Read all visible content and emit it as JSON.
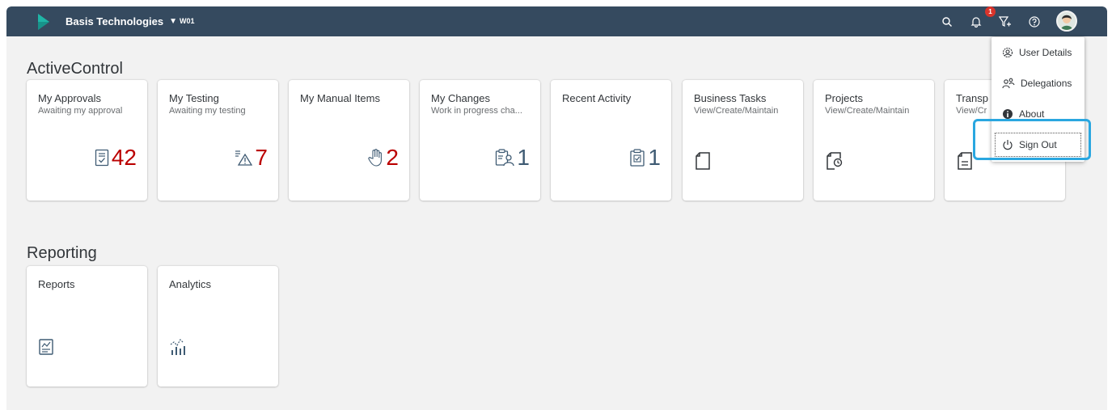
{
  "shell": {
    "company": "Basis Technologies",
    "system": "W01",
    "notification_count": "1",
    "colors": {
      "bar": "#354a5f",
      "logo": "#1fb5a6",
      "kpi_red": "#bb0000",
      "icon_blue": "#3f5b73"
    }
  },
  "active_control": {
    "title": "ActiveControl",
    "tiles": [
      {
        "title": "My Approvals",
        "subtitle": "Awaiting my approval",
        "value": "42",
        "icon": "approval-doc-icon"
      },
      {
        "title": "My Testing",
        "subtitle": "Awaiting my testing",
        "value": "7",
        "icon": "warning-list-icon"
      },
      {
        "title": "My Manual Items",
        "subtitle": "",
        "value": "2",
        "icon": "hand-icon"
      },
      {
        "title": "My Changes",
        "subtitle": "Work in progress cha...",
        "value": "1",
        "icon": "clipboard-person-icon"
      },
      {
        "title": "Recent Activity",
        "subtitle": "",
        "value": "1",
        "icon": "clipboard-check-icon"
      },
      {
        "title": "Business Tasks",
        "subtitle": "View/Create/Maintain",
        "value": "",
        "icon": "document-icon"
      },
      {
        "title": "Projects",
        "subtitle": "View/Create/Maintain",
        "value": "",
        "icon": "document-clock-icon"
      },
      {
        "title": "Transp",
        "subtitle": "View/Cr",
        "value": "",
        "icon": "document-text-icon"
      }
    ]
  },
  "reporting": {
    "title": "Reporting",
    "tiles": [
      {
        "title": "Reports",
        "icon": "report-icon"
      },
      {
        "title": "Analytics",
        "icon": "analytics-icon"
      }
    ]
  },
  "user_menu": {
    "items": [
      {
        "label": "User Details",
        "icon": "user-settings-icon"
      },
      {
        "label": "Delegations",
        "icon": "delegations-icon"
      },
      {
        "label": "About",
        "icon": "info-icon"
      },
      {
        "label": "Sign Out",
        "icon": "power-icon"
      }
    ]
  }
}
